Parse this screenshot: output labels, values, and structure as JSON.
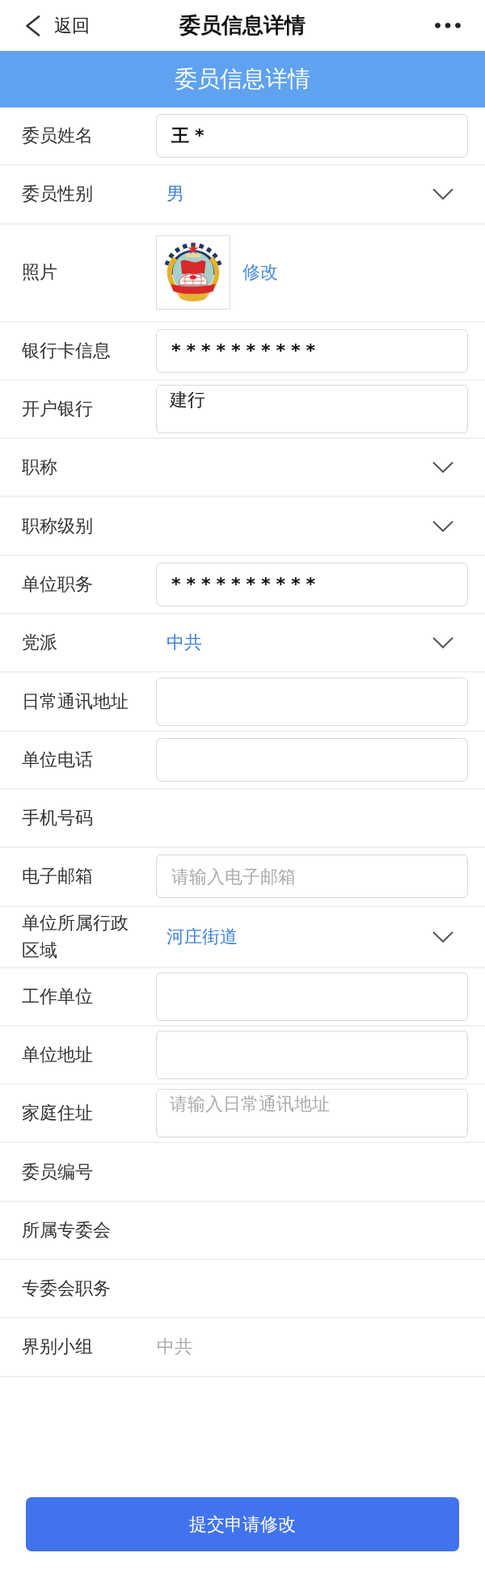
{
  "nav_bar": {
    "back_label": "返回",
    "title": "委员信息详情"
  },
  "banner": {
    "title": "委员信息详情"
  },
  "fields": [
    {
      "kind": "input",
      "label": "委员姓名",
      "value": "王*"
    },
    {
      "kind": "select",
      "label": "委员性别",
      "value": "男"
    },
    {
      "kind": "photo",
      "label": "照片",
      "action": "修改"
    },
    {
      "kind": "input",
      "label": "银行卡信息",
      "value": "**********"
    },
    {
      "kind": "textarea",
      "label": "开户银行",
      "value": "建行"
    },
    {
      "kind": "select",
      "label": "职称"
    },
    {
      "kind": "select",
      "label": "职称级别"
    },
    {
      "kind": "input",
      "label": "单位职务",
      "value": "**********"
    },
    {
      "kind": "select",
      "label": "党派",
      "value": "中共"
    },
    {
      "kind": "textarea",
      "label": "日常通讯地址"
    },
    {
      "kind": "input",
      "label": "单位电话"
    },
    {
      "kind": "text",
      "label": "手机号码"
    },
    {
      "kind": "input",
      "label": "电子邮箱",
      "placeholder": "请输入电子邮箱"
    },
    {
      "kind": "select",
      "label": "单位所属行政区域",
      "value": "河庄街道"
    },
    {
      "kind": "textarea",
      "label": "工作单位"
    },
    {
      "kind": "textarea",
      "label": "单位地址"
    },
    {
      "kind": "textarea",
      "label": "家庭住址",
      "placeholder": "请输入日常通讯地址"
    },
    {
      "kind": "text",
      "label": "委员编号"
    },
    {
      "kind": "text",
      "label": "所属专委会"
    },
    {
      "kind": "text",
      "label": "专委会职务"
    },
    {
      "kind": "text",
      "label": "界别小组",
      "value": "中共"
    }
  ],
  "submit_button": {
    "label": "提交申请修改"
  }
}
